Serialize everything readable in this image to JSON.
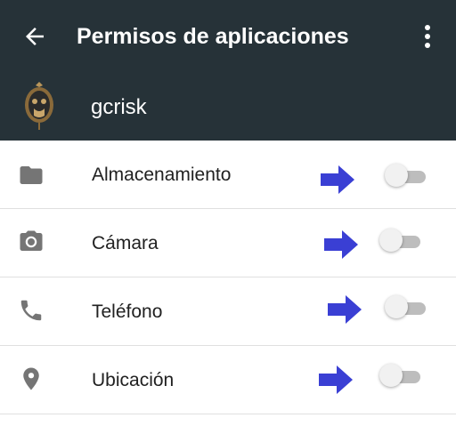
{
  "colors": {
    "toolbar_bg": "#263238",
    "text_light": "#ffffff",
    "arrow": "#3a3fd4",
    "switch_off_track": "#bdbdbd",
    "switch_off_thumb": "#f1f1f1",
    "icon_gray": "#757575"
  },
  "header": {
    "title": "Permisos de aplicaciones",
    "back_icon": "arrow-left-icon",
    "menu_icon": "more-vert-icon"
  },
  "app": {
    "name": "gcrisk",
    "icon": "app-logo-icon"
  },
  "permissions": [
    {
      "label": "Almacenamiento",
      "icon": "folder-icon",
      "enabled": false
    },
    {
      "label": "Cámara",
      "icon": "camera-icon",
      "enabled": false
    },
    {
      "label": "Teléfono",
      "icon": "phone-icon",
      "enabled": false
    },
    {
      "label": "Ubicación",
      "icon": "location-pin-icon",
      "enabled": false
    }
  ]
}
